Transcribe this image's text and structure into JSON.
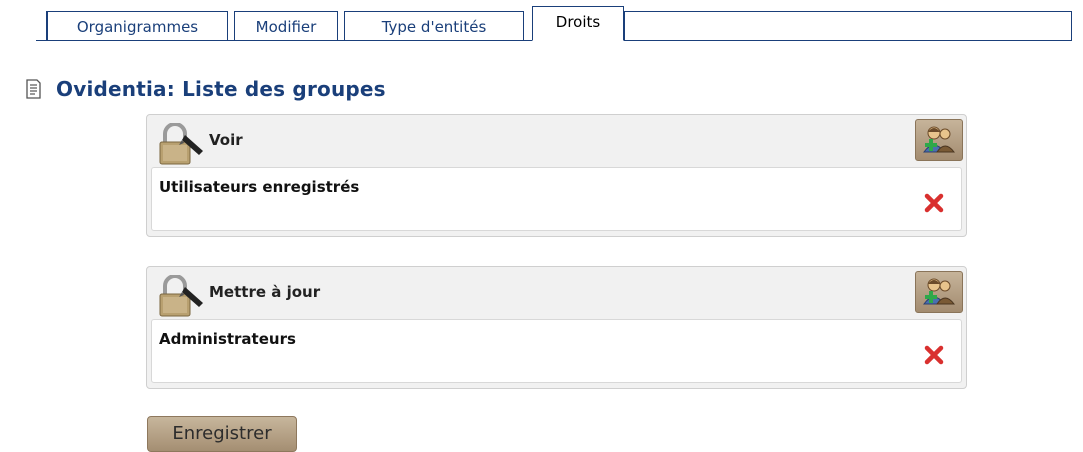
{
  "tabs": [
    {
      "label": "Organigrammes"
    },
    {
      "label": "Modifier"
    },
    {
      "label": "Type d'entités"
    },
    {
      "label": "Droits"
    }
  ],
  "page_title": "Ovidentia: Liste des groupes",
  "panels": [
    {
      "title": "Voir",
      "groups": [
        {
          "name": "Utilisateurs enregistrés"
        }
      ]
    },
    {
      "title": "Mettre à jour",
      "groups": [
        {
          "name": "Administrateurs"
        }
      ]
    }
  ],
  "save_label": "Enregistrer",
  "icons": {
    "page": "document-icon",
    "lock": "lock-pen-icon",
    "add": "add-group-icon",
    "delete": "red-x-icon"
  },
  "colors": {
    "link": "#1a3f7a",
    "button": "#b4a083",
    "delete": "#d9302f"
  }
}
